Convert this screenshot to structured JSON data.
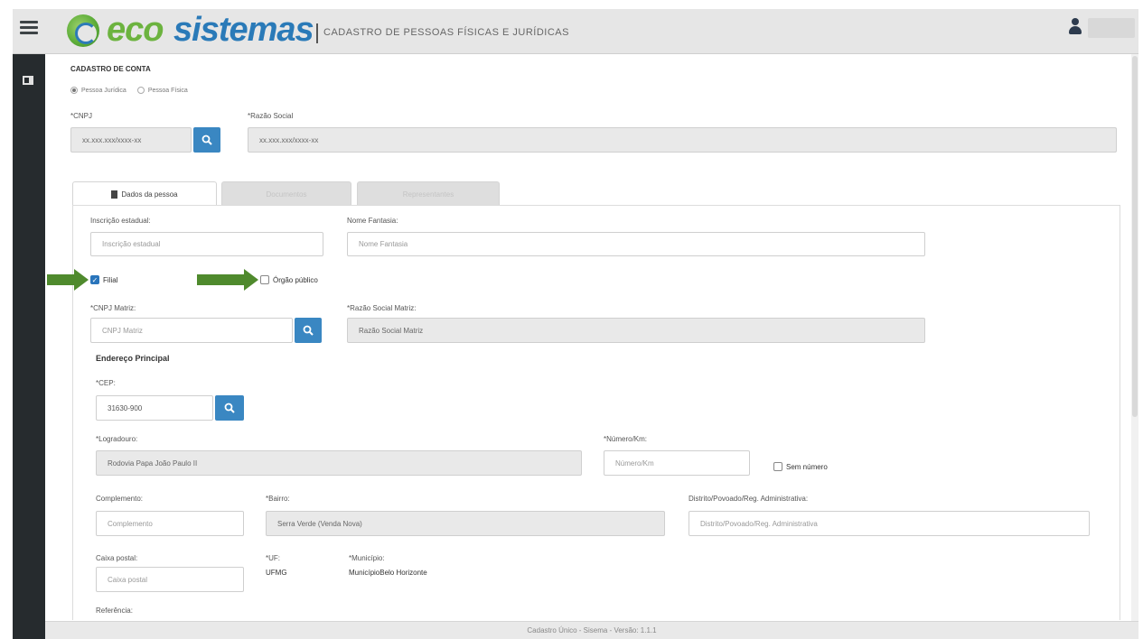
{
  "header": {
    "logo_eco": "eco",
    "logo_sistemas": "sistemas",
    "subtitle": "CADASTRO DE PESSOAS FÍSICAS E JURÍDICAS",
    "menu_icon": "hamburger-icon",
    "user_icon": "user-icon"
  },
  "account": {
    "title": "CADASTRO DE CONTA",
    "person_types": [
      "Pessoa Jurídica",
      "Pessoa Física"
    ],
    "selected_type": "Pessoa Jurídica",
    "cnpj_label": "*CNPJ",
    "cnpj_value": "xx.xxx.xxx/xxxx-xx",
    "razao_label": "*Razão Social",
    "razao_value": "xx.xxx.xxx/xxxx-xx"
  },
  "tabs": [
    {
      "label": "Dados da pessoa",
      "active": true
    },
    {
      "label": "Documentos",
      "active": false
    },
    {
      "label": "Representantes",
      "active": false
    }
  ],
  "form": {
    "inscricao_label": "Inscrição estadual:",
    "inscricao_placeholder": "Inscrição estadual",
    "fantasia_label": "Nome Fantasia:",
    "fantasia_placeholder": "Nome Fantasia",
    "filial_label": "Filial",
    "filial_checked": true,
    "orgao_label": "Órgão público",
    "orgao_checked": false,
    "cnpj_matriz_label": "*CNPJ Matriz:",
    "cnpj_matriz_placeholder": "CNPJ Matriz",
    "razao_matriz_label": "*Razão Social Matriz:",
    "razao_matriz_placeholder": "Razão Social Matriz",
    "endereco_title": "Endereço Principal",
    "cep_label": "*CEP:",
    "cep_value": "31630-900",
    "logradouro_label": "*Logradouro:",
    "logradouro_value": "Rodovia Papa João Paulo II",
    "numero_label": "*Número/Km:",
    "numero_placeholder": "Número/Km",
    "sem_numero_label": "Sem número",
    "complemento_label": "Complemento:",
    "complemento_placeholder": "Complemento",
    "bairro_label": "*Bairro:",
    "bairro_value": "Serra Verde (Venda Nova)",
    "distrito_label": "Distrito/Povoado/Reg. Administrativa:",
    "distrito_placeholder": "Distrito/Povoado/Reg. Administrativa",
    "caixa_label": "Caixa postal:",
    "caixa_placeholder": "Caixa postal",
    "uf_label": "*UF:",
    "uf_value": "UFMG",
    "municipio_label": "*Município:",
    "municipio_value": "MunicípioBelo Horizonte",
    "referencia_label": "Referência:"
  },
  "footer": {
    "text": "Cadastro Único - Sisema - Versão: 1.1.1"
  }
}
